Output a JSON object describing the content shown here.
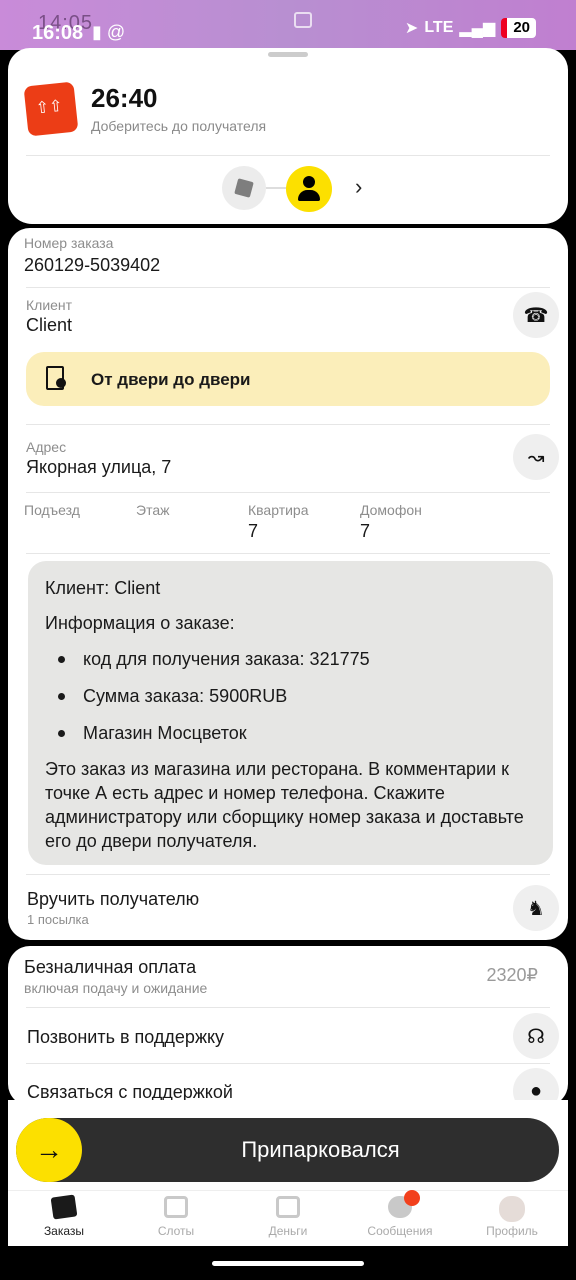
{
  "status_bar": {
    "time": "16:08",
    "ghost_time": "14:05",
    "network": "LTE",
    "battery": "20"
  },
  "header": {
    "timer": "26:40",
    "subtitle": "Доберитесь до получателя"
  },
  "order": {
    "number_label": "Номер заказа",
    "number": "260129-5039402",
    "client_label": "Клиент",
    "client": "Client",
    "delivery_type": "От двери до двери",
    "address_label": "Адрес",
    "address": "Якорная улица, 7",
    "details": [
      {
        "label": "Подъезд",
        "value": ""
      },
      {
        "label": "Этаж",
        "value": ""
      },
      {
        "label": "Квартира",
        "value": "7"
      },
      {
        "label": "Домофон",
        "value": "7"
      }
    ]
  },
  "comment": {
    "client_line": "Клиент: Client",
    "info_title": "Информация о заказе:",
    "bullets": [
      "код для получения заказа: 321775",
      "Сумма заказа: 5900RUB",
      "Магазин Мосцветок"
    ],
    "paragraph": "Это заказ из магазина или ресторана. В комментарии к точке А есть адрес и номер телефона. Скажите администратору или сборщику номер заказа и доставьте его до двери получателя."
  },
  "handover": {
    "title": "Вручить получателю",
    "subtitle": "1 посылка"
  },
  "payment": {
    "title": "Безналичная оплата",
    "subtitle": "включая подачу и ожидание",
    "amount": "2320₽"
  },
  "support": {
    "call": "Позвонить в поддержку",
    "chat": "Связаться с поддержкой"
  },
  "action": {
    "label": "Припарковался"
  },
  "tabs": [
    {
      "label": "Заказы",
      "icon": "box-icon",
      "active": true
    },
    {
      "label": "Слоты",
      "icon": "calendar-icon",
      "active": false
    },
    {
      "label": "Деньги",
      "icon": "wallet-icon",
      "active": false
    },
    {
      "label": "Сообщения",
      "icon": "chat-icon",
      "active": false
    },
    {
      "label": "Профиль",
      "icon": "avatar",
      "active": false
    }
  ],
  "colors": {
    "accent": "#fce000",
    "brand_box": "#ec3d16",
    "door_banner": "#fbeeba",
    "comment_bg": "#e6e6e4",
    "action_bg": "#2e2e2e"
  }
}
